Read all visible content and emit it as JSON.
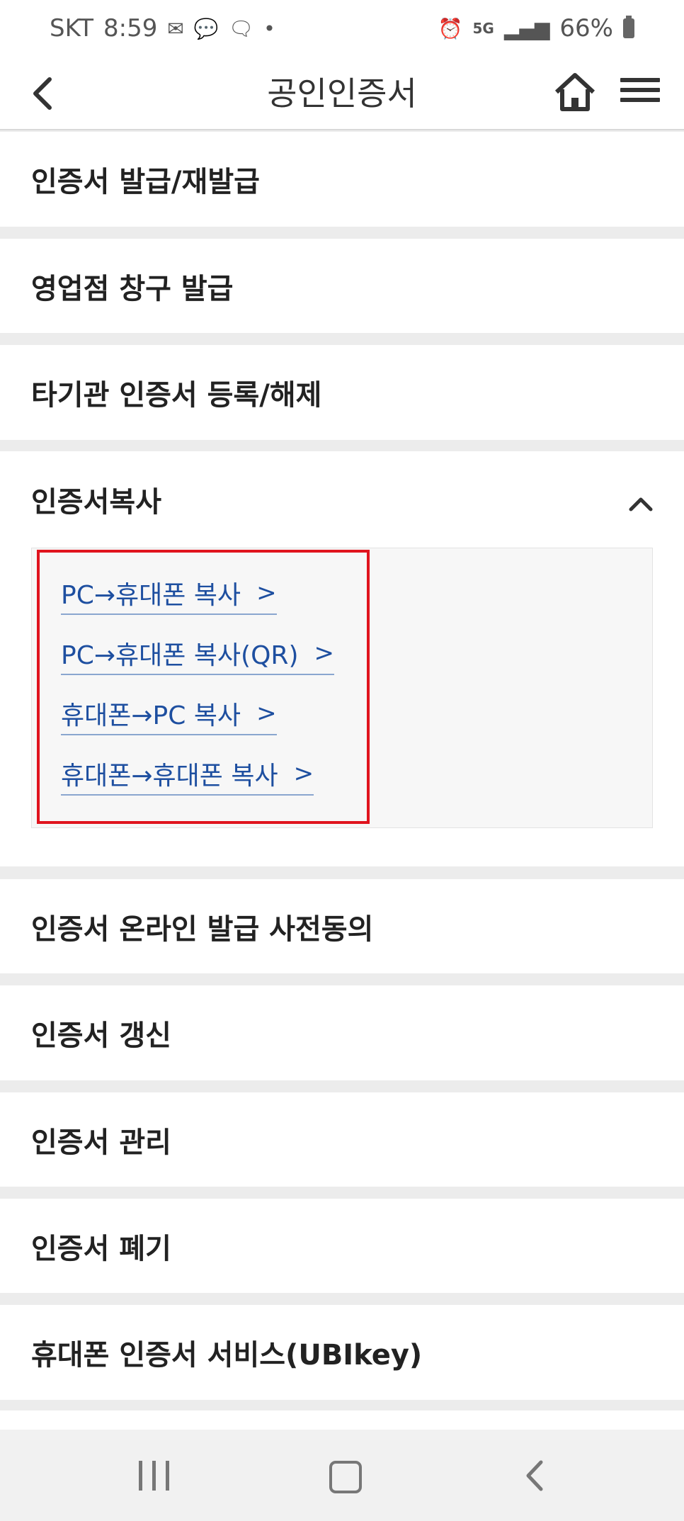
{
  "status_bar": {
    "carrier": "SKT",
    "time": "8:59",
    "left_icons": [
      "mail-icon",
      "message-icon",
      "talk-icon",
      "dot-icon"
    ],
    "network": "5G",
    "battery": "66%"
  },
  "header": {
    "title": "공인인증서",
    "icons": [
      "back-arrow-icon",
      "home-icon",
      "hamburger-menu-icon"
    ]
  },
  "menu": {
    "items_top": [
      "인증서 발급/재발급",
      "영업점 창구 발급",
      "타기관 인증서 등록/해제"
    ],
    "expanded": {
      "label": "인증서복사",
      "sub_items": [
        "PC→휴대폰 복사",
        "PC→휴대폰 복사(QR)",
        "휴대폰→PC 복사",
        "휴대폰→휴대폰 복사"
      ]
    },
    "items_bottom": [
      "인증서 온라인 발급 사전동의",
      "인증서 갱신",
      "인증서 관리",
      "인증서 폐기",
      "휴대폰 인증서 서비스(UBIkey)"
    ]
  },
  "colors": {
    "link": "#1e4fa0",
    "highlight": "#e0141e",
    "divider": "#ececec"
  }
}
